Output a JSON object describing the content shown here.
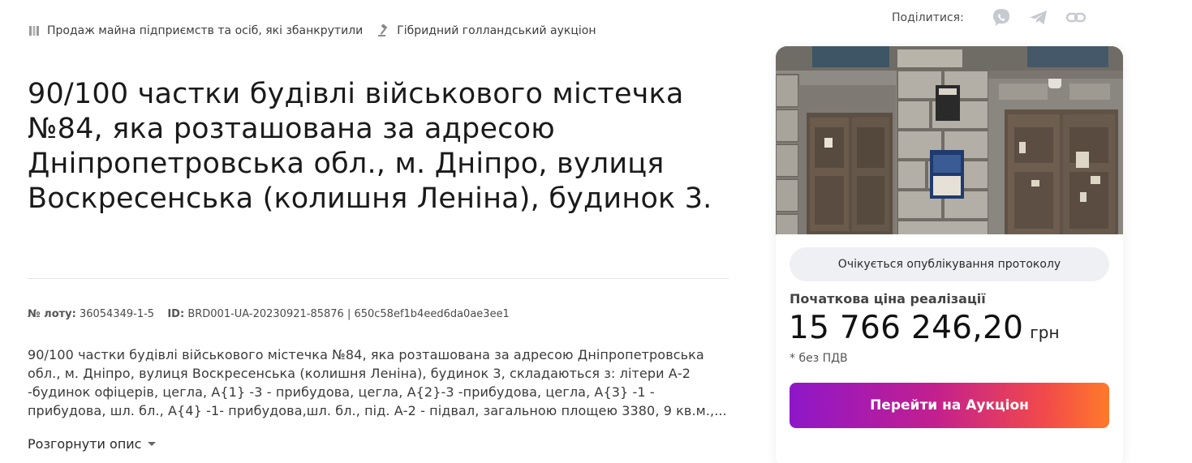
{
  "breadcrumbs": [
    {
      "icon": "building-columns-icon",
      "label": "Продаж майна підприємств та осіб, які збанкрутили"
    },
    {
      "icon": "gavel-icon",
      "label": "Гібридний голландський аукціон"
    }
  ],
  "share": {
    "label": "Поділитися:",
    "icons": [
      "viber-icon",
      "telegram-icon",
      "link-icon"
    ]
  },
  "lot": {
    "title": "90/100 частки будівлі військового містечка №84, яка розташована за адресою Дніпропетровська обл., м. Дніпро, вулиця Воскресенська (колишня Леніна), будинок 3.",
    "lot_number_label": "№ лоту:",
    "lot_number": "36054349-1-5",
    "id_label": "ID:",
    "id_value": "BRD001-UA-20230921-85876 | 650c58ef1b4eed6da0ae3ee1",
    "description": "90/100 частки будівлі військового містечка №84, яка розташована за адресою Дніпропетровська обл., м. Дніпро, вулиця Воскресенська (колишня Леніна), будинок 3, складаються з: літери А-2 -будинок офіцерів, цегла, А{1} -3 - прибудова, цегла, А{2}-3 -прибудова, цегла, А{3} -1 - прибудова, шл. бл., А{4} -1- прибудова,шл. бл., під. А-2 - підвал, загальною площею 3380, 9 кв.м.,...",
    "expand_label": "Розгорнути опис"
  },
  "card": {
    "status": "Очікується опублікування протоколу",
    "price_label": "Початкова ціна реалізації",
    "price": "15 766 246,20",
    "currency": "грн",
    "vat_note": "* без ПДВ",
    "cta_label": "Перейти на Аукціон",
    "cta_gradient": [
      "#8e17c9",
      "#c21f8f",
      "#f24a4a",
      "#ff7a2a"
    ]
  }
}
